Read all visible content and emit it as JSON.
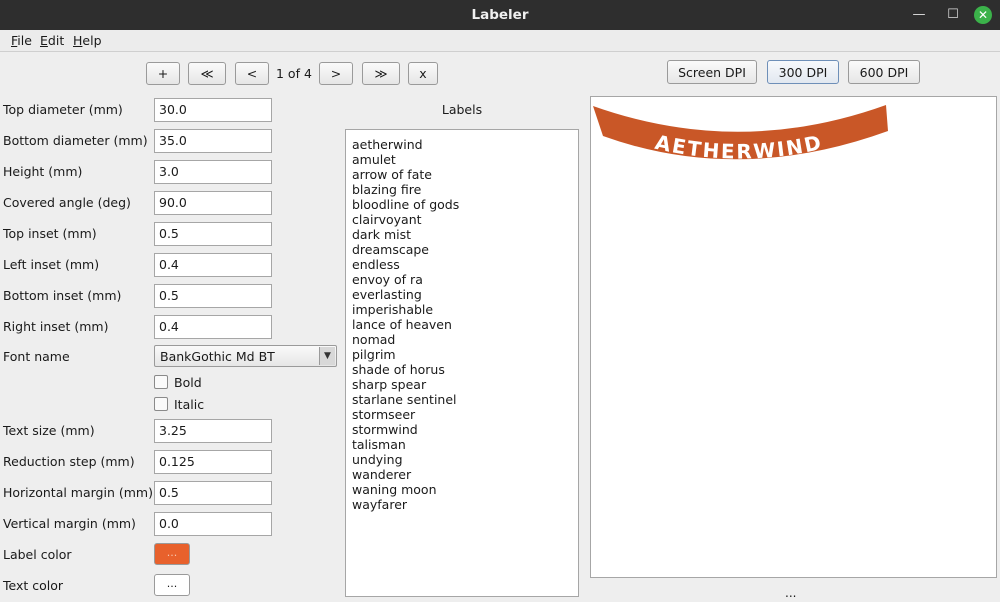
{
  "window": {
    "title": "Labeler",
    "minimize_glyph": "—",
    "maximize_glyph": "☐",
    "close_glyph": "✕"
  },
  "menu": [
    {
      "first": "F",
      "rest": "ile"
    },
    {
      "first": "E",
      "rest": "dit"
    },
    {
      "first": "H",
      "rest": "elp"
    }
  ],
  "pager": {
    "add": "+",
    "first": "≪",
    "prev": "<",
    "indicator": "1 of 4",
    "next": ">",
    "last": "≫",
    "remove": "x"
  },
  "dpi": {
    "screen": "Screen DPI",
    "dpi300": "300 DPI",
    "dpi600": "600 DPI",
    "selected": "300 DPI"
  },
  "form": {
    "top_diameter": {
      "label": "Top diameter (mm)",
      "value": "30.0"
    },
    "bottom_diameter": {
      "label": "Bottom diameter (mm)",
      "value": "35.0"
    },
    "height": {
      "label": "Height (mm)",
      "value": "3.0"
    },
    "covered_angle": {
      "label": "Covered angle (deg)",
      "value": "90.0"
    },
    "top_inset": {
      "label": "Top inset (mm)",
      "value": "0.5"
    },
    "left_inset": {
      "label": "Left inset (mm)",
      "value": "0.4"
    },
    "bottom_inset": {
      "label": "Bottom inset (mm)",
      "value": "0.5"
    },
    "right_inset": {
      "label": "Right inset (mm)",
      "value": "0.4"
    },
    "font_name": {
      "label": "Font name",
      "value": "BankGothic Md BT"
    },
    "bold": {
      "label": "Bold",
      "checked": false
    },
    "italic": {
      "label": "Italic",
      "checked": false
    },
    "text_size": {
      "label": "Text size (mm)",
      "value": "3.25"
    },
    "reduction_step": {
      "label": "Reduction step (mm)",
      "value": "0.125"
    },
    "horizontal_margin": {
      "label": "Horizontal margin (mm)",
      "value": "0.5"
    },
    "vertical_margin": {
      "label": "Vertical margin (mm)",
      "value": "0.0"
    },
    "label_color": {
      "label": "Label color",
      "button": "...",
      "color": "#e8612c"
    },
    "text_color": {
      "label": "Text color",
      "button": "...",
      "color": "#ffffff"
    }
  },
  "labels": {
    "title": "Labels",
    "items": [
      "aetherwind",
      "amulet",
      "arrow of fate",
      "blazing fire",
      "bloodline of gods",
      "clairvoyant",
      "dark mist",
      "dreamscape",
      "endless",
      "envoy of ra",
      "everlasting",
      "imperishable",
      "lance of heaven",
      "nomad",
      "pilgrim",
      "shade of horus",
      "sharp spear",
      "starlane sentinel",
      "stormseer",
      "stormwind",
      "talisman",
      "undying",
      "wanderer",
      "waning moon",
      "wayfarer"
    ]
  },
  "preview": {
    "text": "AETHERWIND",
    "band_color": "#c95727",
    "text_color": "#ffffff"
  },
  "status": {
    "text": "..."
  }
}
